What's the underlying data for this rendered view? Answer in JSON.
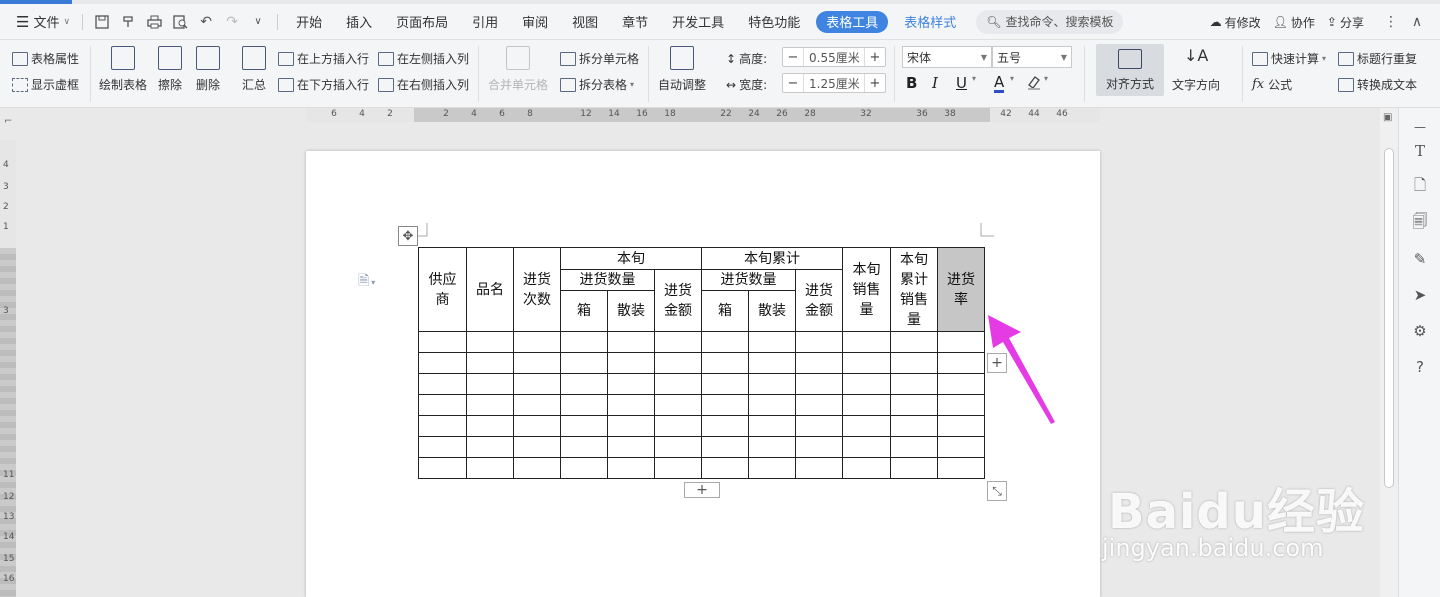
{
  "menubar": {
    "file": "文件",
    "tabs": [
      "开始",
      "插入",
      "页面布局",
      "引用",
      "审阅",
      "视图",
      "章节",
      "开发工具",
      "特色功能"
    ],
    "active_tab": "表格工具",
    "context_tab": "表格样式",
    "search_placeholder": "查找命令、搜索模板",
    "right": {
      "modified": "有修改",
      "collab": "协作",
      "share": "分享"
    }
  },
  "ribbon": {
    "table_props": "表格属性",
    "show_gridlines": "显示虚框",
    "draw_table": "绘制表格",
    "erase": "擦除",
    "delete": "删除",
    "summary": "汇总",
    "insert_above": "在上方插入行",
    "insert_below": "在下方插入行",
    "insert_left": "在左侧插入列",
    "insert_right": "在右侧插入列",
    "merge_cells": "合并单元格",
    "split_cells": "拆分单元格",
    "split_table": "拆分表格",
    "auto_fit": "自动调整",
    "height_label": "高度:",
    "height_value": "0.55厘米",
    "width_label": "宽度:",
    "width_value": "1.25厘米",
    "font_name": "宋体",
    "font_size": "五号",
    "bold": "B",
    "italic": "I",
    "underline": "U",
    "font_color": "A",
    "align": "对齐方式",
    "text_direction": "文字方向",
    "quick_calc": "快速计算",
    "formula": "公式",
    "repeat_header": "标题行重复",
    "to_text": "转换成文本"
  },
  "ruler": {
    "h_numbers": [
      "6",
      "4",
      "2",
      "2",
      "4",
      "6",
      "8",
      "12",
      "14",
      "16",
      "18",
      "22",
      "24",
      "26",
      "28",
      "32",
      "36",
      "38",
      "42",
      "44",
      "46"
    ],
    "v_numbers": [
      "4",
      "3",
      "2",
      "1",
      "3",
      "11",
      "12",
      "13",
      "14",
      "15",
      "16"
    ]
  },
  "table": {
    "col_supplier": "供应\n商",
    "col_product": "品名",
    "col_times": "进货\n次数",
    "group_period": "本旬",
    "group_cumulative": "本旬累计",
    "sub_qty": "进货数量",
    "sub_box": "箱",
    "sub_loose": "散装",
    "sub_amount": "进货\n金额",
    "col_sales": "本旬\n销售\n量",
    "col_cum_sales": "本旬\n累计\n销售\n量",
    "col_rate": "进货\n率",
    "empty_rows": 7,
    "cols": 12
  },
  "watermark": {
    "brand": "Baidu经验",
    "url": "jingyan.baidu.com"
  },
  "colors": {
    "accent": "#3e84e0",
    "arrow": "#e43be4",
    "selected_cell": "#c6c6c6"
  }
}
